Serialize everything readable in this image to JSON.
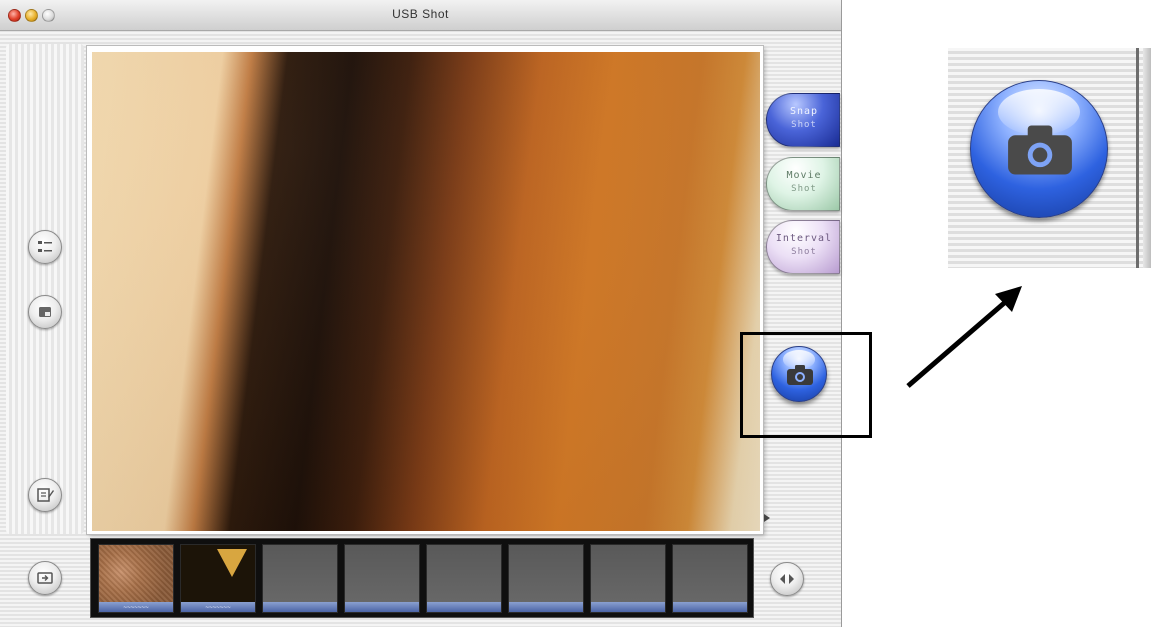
{
  "window": {
    "title": "USB Shot"
  },
  "capture_buttons": {
    "snap": {
      "line1": "Snap",
      "line2": "Shot"
    },
    "movie": {
      "line1": "Movie",
      "line2": "Shot"
    },
    "interval": {
      "line1": "Interval",
      "line2": "Shot"
    }
  },
  "left_tools": [
    {
      "icon": "settings-list-icon"
    },
    {
      "icon": "save-photo-icon"
    },
    {
      "icon": "edit-note-icon"
    },
    {
      "icon": "export-icon"
    }
  ],
  "camera_button": {
    "icon": "camera-icon"
  },
  "thumbnails": [
    {
      "type": "image-noise",
      "caption": "~~~~~~~"
    },
    {
      "type": "image-dark",
      "caption": "~~~~~~~"
    },
    {
      "type": "empty",
      "caption": ""
    },
    {
      "type": "empty",
      "caption": ""
    },
    {
      "type": "empty",
      "caption": ""
    },
    {
      "type": "empty",
      "caption": ""
    },
    {
      "type": "empty",
      "caption": ""
    },
    {
      "type": "empty",
      "caption": ""
    }
  ],
  "strip_nav": {
    "icon": "prev-next-arrows-icon"
  }
}
